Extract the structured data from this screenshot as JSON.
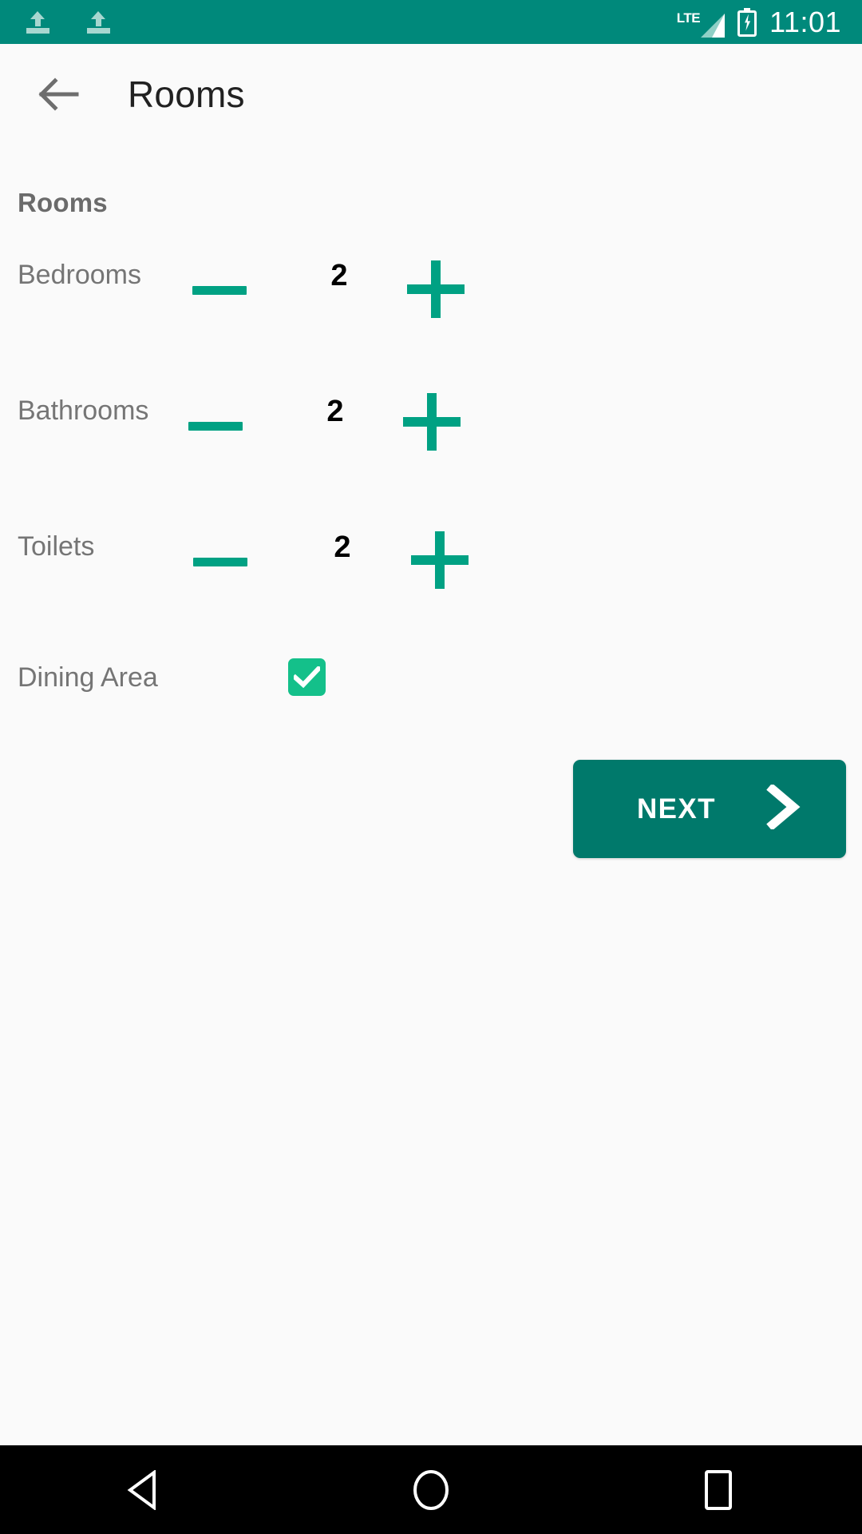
{
  "statusbar": {
    "notifications": [
      {
        "icon": "upload-icon"
      },
      {
        "icon": "upload-icon"
      }
    ],
    "network_label": "LTE",
    "signal_icon": "signal-bars-icon",
    "battery_icon": "battery-charging-icon",
    "time": "11:01",
    "background_color": "#00897b"
  },
  "appbar": {
    "back_icon": "back-arrow-icon",
    "title": "Rooms"
  },
  "content": {
    "section_header": "Rooms",
    "steppers": [
      {
        "label": "Bedrooms",
        "value": "2",
        "minus_icon": "minus-icon",
        "plus_icon": "plus-icon"
      },
      {
        "label": "Bathrooms",
        "value": "2",
        "minus_icon": "minus-icon",
        "plus_icon": "plus-icon"
      },
      {
        "label": "Toilets",
        "value": "2",
        "minus_icon": "minus-icon",
        "plus_icon": "plus-icon"
      }
    ],
    "checkbox_row": {
      "label": "Dining Area",
      "checked": true,
      "check_icon": "checkmark-icon",
      "color": "#14c08a"
    },
    "next_button": {
      "label": "NEXT",
      "icon": "chevron-right-icon",
      "background_color": "#00796b"
    },
    "accent_color": "#00a183"
  },
  "navbar": {
    "items": [
      {
        "icon": "nav-back-triangle-icon"
      },
      {
        "icon": "nav-home-circle-icon"
      },
      {
        "icon": "nav-recents-square-icon"
      }
    ]
  }
}
